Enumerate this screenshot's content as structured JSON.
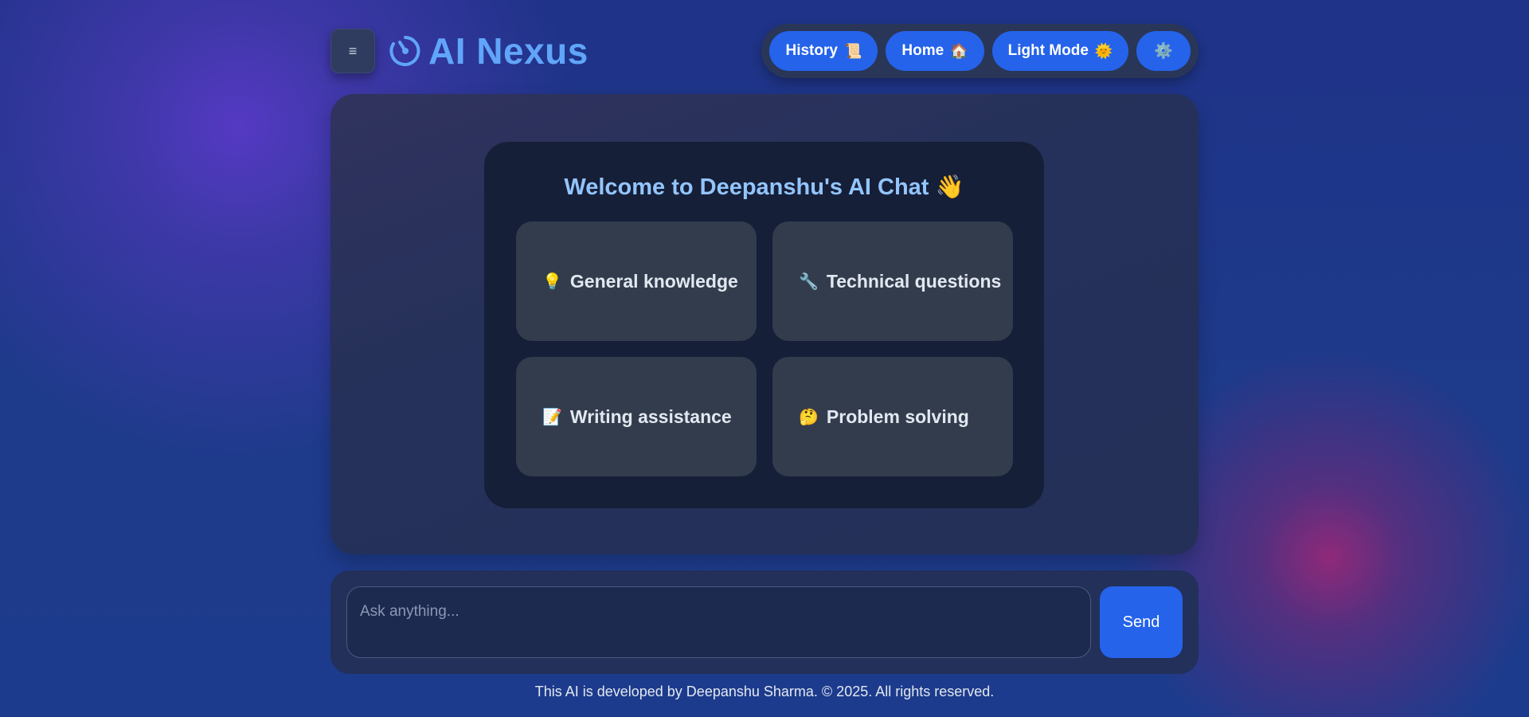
{
  "header": {
    "menu_icon": "≡",
    "brand_icon": "spinner-logo-icon",
    "title": "AI Nexus"
  },
  "nav": {
    "items": [
      {
        "label": "History",
        "emoji": "📜"
      },
      {
        "label": "Home",
        "emoji": "🏠"
      },
      {
        "label": "Light Mode",
        "emoji": "🌞"
      }
    ],
    "settings_icon": "⚙️"
  },
  "welcome": {
    "title": "Welcome to Deepanshu's AI Chat 👋",
    "suggestions": [
      {
        "emoji": "💡",
        "label": "General knowledge"
      },
      {
        "emoji": "🔧",
        "label": "Technical questions"
      },
      {
        "emoji": "📝",
        "label": "Writing assistance"
      },
      {
        "emoji": "🤔",
        "label": "Problem solving"
      }
    ]
  },
  "composer": {
    "placeholder": "Ask anything...",
    "value": "",
    "send_label": "Send"
  },
  "footer": {
    "text": "This AI is developed by Deepanshu Sharma. © 2025. All rights reserved."
  },
  "colors": {
    "accent": "#2563eb",
    "brand": "#60a5fa",
    "welcome_title": "#93c5fd",
    "card": "#323c4d"
  }
}
